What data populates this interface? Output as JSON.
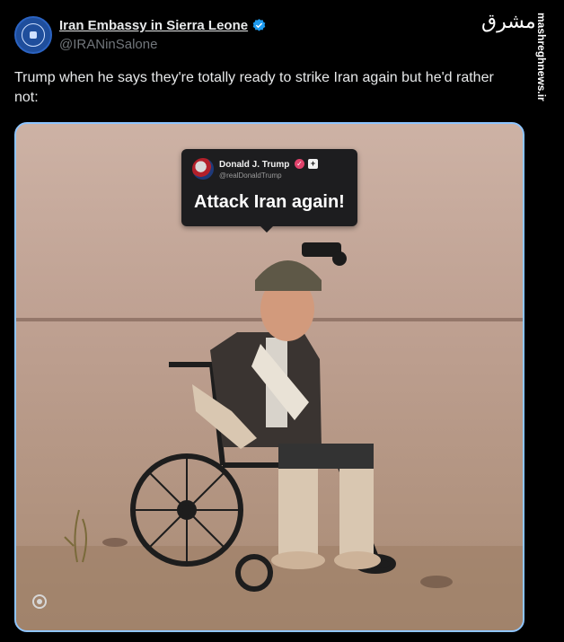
{
  "author": {
    "display_name": "Iran Embassy in Sierra Leone",
    "handle": "@IRANinSalone"
  },
  "tweet": {
    "text": "Trump when he says they're totally ready to strike Iran again but he'd rather not:"
  },
  "media": {
    "embedded_post": {
      "name": "Donald J. Trump",
      "handle": "@realDonaldTrump",
      "text": "Attack Iran again!",
      "plus": "+"
    }
  },
  "brand": {
    "logo_text": "مشرق",
    "watermark": "mashreghnews.ir"
  },
  "colors": {
    "background": "#000000",
    "text": "#e7e9ea",
    "secondary": "#71767b",
    "verified": "#1d9bf0",
    "media_border": "#8ec5ff"
  }
}
